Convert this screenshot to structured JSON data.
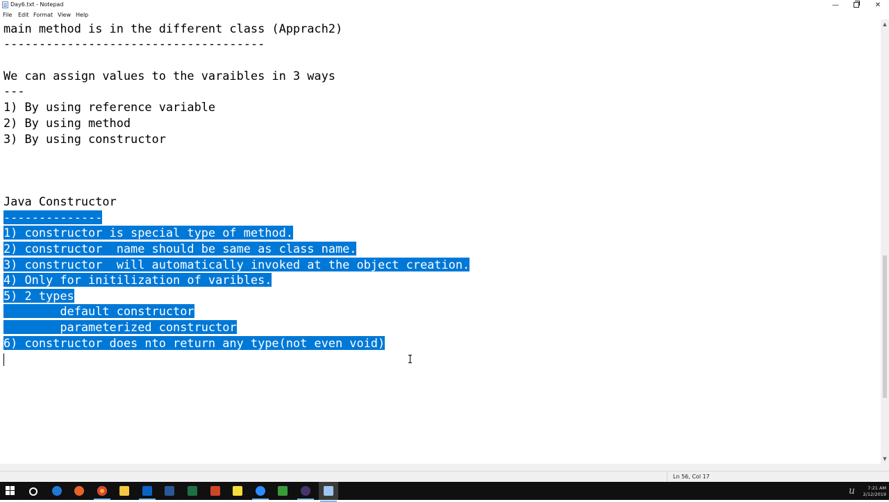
{
  "window": {
    "title": "Day6.txt - Notepad",
    "minimize_glyph": "—",
    "close_glyph": "✕"
  },
  "menu": [
    "File",
    "Edit",
    "Format",
    "View",
    "Help"
  ],
  "editor": {
    "lines": [
      "main method is in the different class (Apprach2)",
      "-------------------------------------",
      "We can assign values to the varaibles in 3 ways",
      "---",
      "1) By using reference variable",
      "2) By using method",
      "3) By using constructor",
      "Java Constructor",
      "--------------",
      "1) constructor is special type of method.",
      "2) constructor  name should be same as class name.",
      "3) constructor  will automatically invoked at the object creation.",
      "4) Only for initilization of varibles.",
      "5) 2 types",
      "        default constructor",
      "        parameterized constructor",
      "6) constructor does nto return any type(not even void)"
    ]
  },
  "statusbar": {
    "position": "Ln 56, Col 17"
  },
  "taskbar": {
    "items": [
      "start",
      "search",
      "edge",
      "firefox",
      "chrome",
      "file-explorer",
      "outlook",
      "word",
      "excel",
      "powerpoint",
      "sticky-notes",
      "zoom",
      "gvim",
      "eclipse",
      "notepad"
    ],
    "colors": {
      "edge": "#1f7ad4",
      "firefox": "#e8632b",
      "chrome": "#f1b51c",
      "file-explorer": "#f6c744",
      "outlook": "#0a64c6",
      "word": "#2b5797",
      "excel": "#1e7145",
      "powerpoint": "#d04525",
      "sticky-notes": "#f5dd3c",
      "zoom": "#2d8cff",
      "gvim": "#3a9b3a",
      "eclipse": "#47346d",
      "notepad": "#9fc6f0"
    },
    "time": "7:21 AM",
    "date": "2/12/2019"
  }
}
